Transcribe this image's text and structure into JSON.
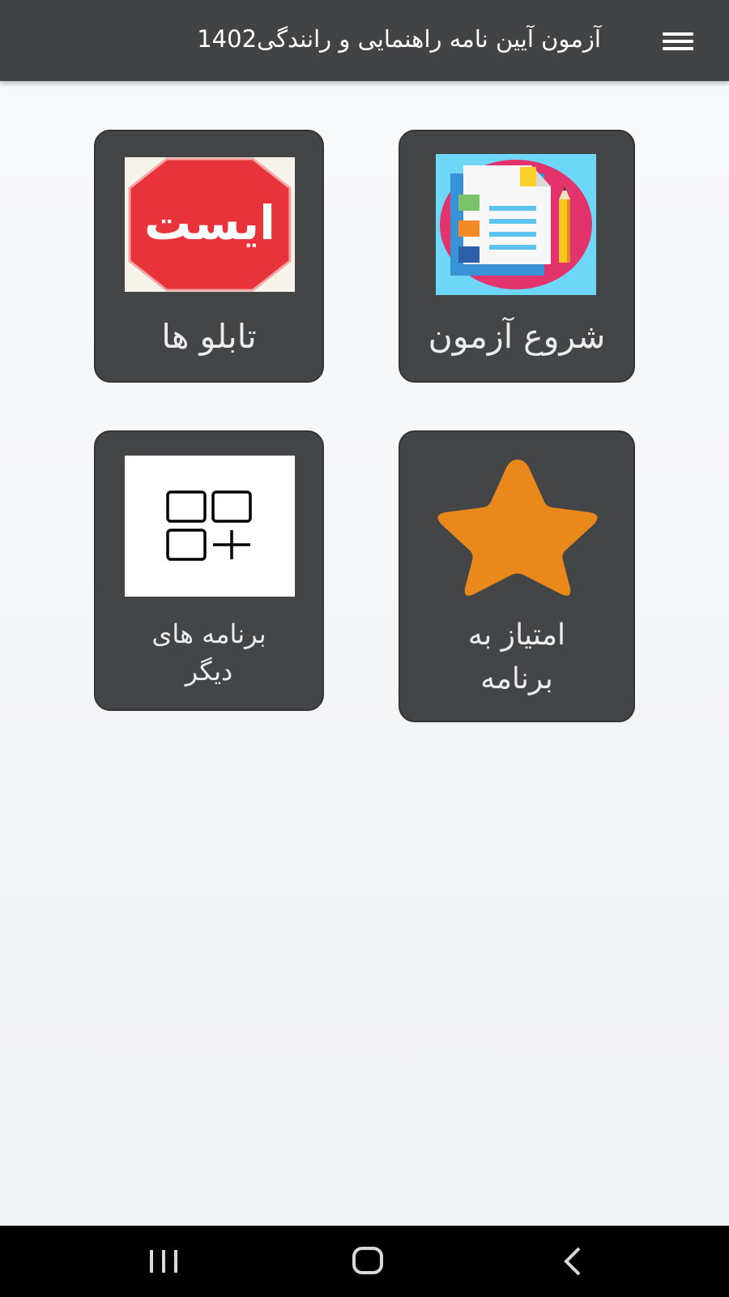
{
  "appbar": {
    "title": "آزمون آیین نامه راهنمایی و رانندگی1402",
    "menu_icon": "hamburger-menu-icon"
  },
  "tiles": [
    {
      "label": "شروع آزمون",
      "icon": "quiz-document-icon"
    },
    {
      "label": "تابلو ها",
      "icon": "stop-sign-icon",
      "icon_text": "ایست"
    },
    {
      "label": "امتیاز به برنامه",
      "icon": "star-icon"
    },
    {
      "label": "برنامه های دیگر",
      "icon": "apps-add-icon"
    }
  ],
  "navbar": {
    "recents_icon": "recent-apps-icon",
    "home_icon": "home-icon",
    "back_icon": "back-icon"
  },
  "colors": {
    "appbar": "#424345",
    "tile": "#444547",
    "star": "#ea881c",
    "stop_sign": "#e8333a"
  }
}
